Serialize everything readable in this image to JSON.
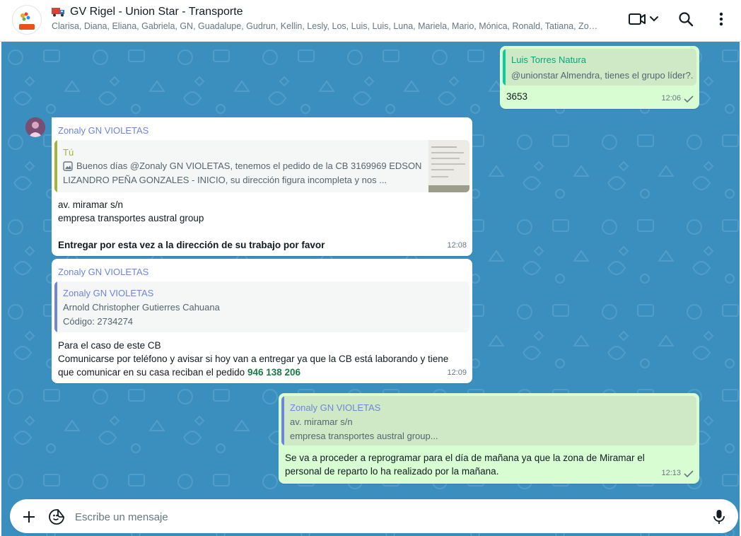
{
  "header": {
    "title": "GV Rigel - Union Star - Transporte",
    "members": "Clarisa, Diana, Eliana, Gabriela, GN, Guadalupe, Gudrun, Kellin, Lesly, Los, Luis, Luis, Luna, Mariela, Mario, Mónica, Ronald, Tatiana, Zon...",
    "avatar_text_top": "unionstar",
    "avatar_text_bottom": "RIGEL"
  },
  "messages": {
    "m1": {
      "quote_name": "Luis Torres Natura",
      "quote_text": "@unionstar Almendra, tienes el grupo líder?.",
      "text": "3653",
      "time": "12:06"
    },
    "m2": {
      "sender": "Zonaly GN VIOLETAS",
      "quote_name": "Tú",
      "quote_line1": "Buenos días @Zonaly GN VIOLETAS, tenemos el pedido de la CB 3169969 EDSON",
      "quote_line2": "LIZANDRO PEÑA GONZALES - INICIO, su dirección figura incompleta y nos ...",
      "line1": "av. miramar s/n",
      "line2": "empresa transportes austral group",
      "line3": "Entregar por esta vez a la dirección de su trabajo por favor",
      "time": "12:08"
    },
    "m3": {
      "sender": "Zonaly GN VIOLETAS",
      "quote_name": "Zonaly GN VIOLETAS",
      "quote_line1": "Arnold Christopher Gutierres Cahuana",
      "quote_line2": "Código: 2734274",
      "line1": "Para el caso de este CB",
      "line2": "Comunicarse por teléfono y avisar si hoy van a entregar ya que la CB está laborando y tiene",
      "line3": "que comunicar en su casa reciban el pedido",
      "phone": "946 138 206",
      "time": "12:09"
    },
    "m4": {
      "quote_name": "Zonaly GN VIOLETAS",
      "quote_line1": "av. miramar s/n",
      "quote_line2": "empresa transportes austral group...",
      "line1": "Se va a proceder a reprogramar para el día de mañana ya que la zona de Miramar el",
      "line2": "personal de reparto lo ha realizado por la mañana.",
      "time": "12:13"
    }
  },
  "composer": {
    "placeholder": "Escribe un mensaje"
  },
  "colors": {
    "chat_bg": "#3a8fbf",
    "outgoing": "#d9fdd3",
    "incoming": "#ffffff",
    "quote_bar_green": "#06cf9c",
    "quote_bar_olive": "#a5b337",
    "quote_bar_blue": "#6f86d6"
  }
}
